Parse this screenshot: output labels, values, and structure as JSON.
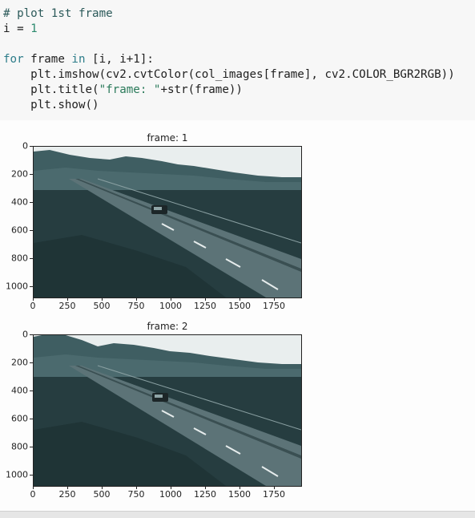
{
  "code": {
    "line1": "# plot 1st frame",
    "line2_var": "i",
    "line2_op": " = ",
    "line2_val": "1",
    "line4_kw1": "for",
    "line4_var": " frame ",
    "line4_kw2": "in",
    "line4_rest": " [i, i+1]:",
    "line5": "    plt.imshow(cv2.cvtColor(col_images[frame], cv2.COLOR_BGR2RGB))",
    "line6_a": "    plt.title(",
    "line6_str": "\"frame: \"",
    "line6_b": "+str(frame))",
    "line7": "    plt.show()"
  },
  "plots": [
    {
      "title": "frame: 1",
      "x_ticks": [
        "0",
        "250",
        "500",
        "750",
        "1000",
        "1250",
        "1500",
        "1750"
      ],
      "y_ticks": [
        "0",
        "200",
        "400",
        "600",
        "800",
        "1000"
      ],
      "image_alt": "road-scene-frame-1"
    },
    {
      "title": "frame: 2",
      "x_ticks": [
        "0",
        "250",
        "500",
        "750",
        "1000",
        "1250",
        "1500",
        "1750"
      ],
      "y_ticks": [
        "0",
        "200",
        "400",
        "600",
        "800",
        "1000"
      ],
      "image_alt": "road-scene-frame-2"
    }
  ],
  "colors": {
    "sky": "#e9eeee",
    "mountain": "#3f5e62",
    "ground": "#2a4245",
    "road": "#5e7478",
    "car": "#1c2628"
  }
}
